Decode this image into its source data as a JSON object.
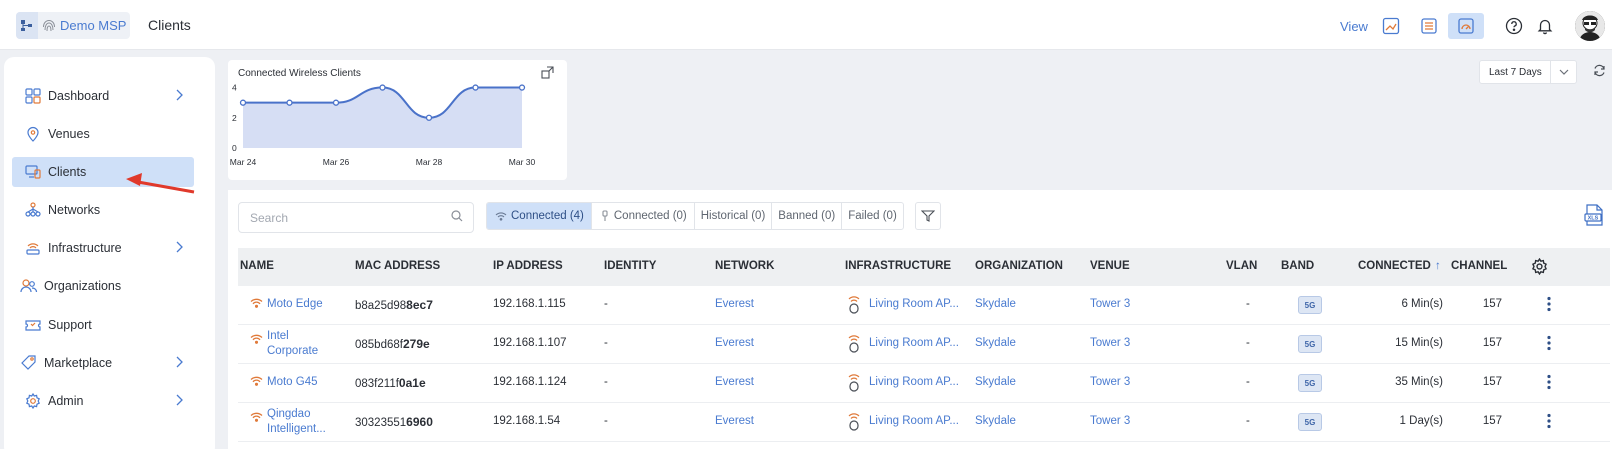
{
  "header": {
    "org_name": "Demo MSP",
    "page_title": "Clients",
    "view_label": "View",
    "view_buttons": [
      "view-map-icon",
      "view-list-icon",
      "view-dashboard-icon"
    ],
    "icons": [
      "help-icon",
      "bell-icon"
    ]
  },
  "sidebar": {
    "items": [
      {
        "label": "Dashboard",
        "icon": "grid-icon",
        "chevron": true
      },
      {
        "label": "Venues",
        "icon": "location-pin-icon",
        "chevron": false
      },
      {
        "label": "Clients",
        "icon": "devices-icon",
        "chevron": false,
        "active": true
      },
      {
        "label": "Networks",
        "icon": "network-icon",
        "chevron": false
      },
      {
        "label": "Infrastructure",
        "icon": "access-point-icon",
        "chevron": true
      },
      {
        "label": "Organizations",
        "icon": "users-icon",
        "chevron": false
      },
      {
        "label": "Support",
        "icon": "ticket-icon",
        "chevron": false
      },
      {
        "label": "Marketplace",
        "icon": "tag-icon",
        "chevron": true
      },
      {
        "label": "Admin",
        "icon": "gear-icon",
        "chevron": true
      }
    ]
  },
  "chart_widget": {
    "title": "Connected Wireless Clients",
    "range": "Last 7 Days"
  },
  "chart_data": {
    "type": "area",
    "title": "Connected Wireless Clients",
    "x": [
      "Mar 24",
      "Mar 25",
      "Mar 26",
      "Mar 27",
      "Mar 28",
      "Mar 29",
      "Mar 30"
    ],
    "x_ticks": [
      "Mar 24",
      "Mar 26",
      "Mar 28",
      "Mar 30"
    ],
    "values": [
      3,
      3,
      3,
      4,
      2,
      4,
      4
    ],
    "y_ticks": [
      0,
      2,
      4
    ],
    "ylim": [
      0,
      4.5
    ],
    "color": "#4a72c9",
    "fill": "#d6def4",
    "grid": false
  },
  "toolbar": {
    "search_placeholder": "Search",
    "tabs": [
      {
        "label": "Connected (4)",
        "icon": "wifi-icon",
        "active": true
      },
      {
        "label": "Connected (0)",
        "icon": "wired-icon",
        "active": false
      },
      {
        "label": "Historical (0)",
        "active": false
      },
      {
        "label": "Banned (0)",
        "active": false
      },
      {
        "label": "Failed (0)",
        "active": false
      }
    ]
  },
  "table": {
    "columns": [
      "NAME",
      "MAC ADDRESS",
      "IP ADDRESS",
      "IDENTITY",
      "NETWORK",
      "INFRASTRUCTURE",
      "ORGANIZATION",
      "VENUE",
      "VLAN",
      "BAND",
      "CONNECTED",
      "CHANNEL"
    ],
    "sort_indicator": "↑",
    "rows": [
      {
        "name": [
          "Moto Edge"
        ],
        "mac_prefix": "b8a25d98",
        "mac_suffix": "8ec7",
        "ip": "192.168.1.115",
        "identity": "-",
        "network": "Everest",
        "infrastructure": "Living Room AP...",
        "organization": "Skydale",
        "venue": "Tower 3",
        "vlan": "-",
        "band": "5G",
        "connected": "6 Min(s)",
        "channel": "157"
      },
      {
        "name": [
          "Intel",
          "Corporate"
        ],
        "mac_prefix": "085bd68f",
        "mac_suffix": "279e",
        "ip": "192.168.1.107",
        "identity": "-",
        "network": "Everest",
        "infrastructure": "Living Room AP...",
        "organization": "Skydale",
        "venue": "Tower 3",
        "vlan": "-",
        "band": "5G",
        "connected": "15 Min(s)",
        "channel": "157"
      },
      {
        "name": [
          "Moto G45"
        ],
        "mac_prefix": "083f211f",
        "mac_suffix": "0a1e",
        "ip": "192.168.1.124",
        "identity": "-",
        "network": "Everest",
        "infrastructure": "Living Room AP...",
        "organization": "Skydale",
        "venue": "Tower 3",
        "vlan": "-",
        "band": "5G",
        "connected": "35 Min(s)",
        "channel": "157"
      },
      {
        "name": [
          "Qingdao",
          "Intelligent..."
        ],
        "mac_prefix": "30323551",
        "mac_suffix": "6960",
        "ip": "192.168.1.54",
        "identity": "-",
        "network": "Everest",
        "infrastructure": "Living Room AP...",
        "organization": "Skydale",
        "venue": "Tower 3",
        "vlan": "-",
        "band": "5G",
        "connected": "1 Day(s)",
        "channel": "157"
      }
    ]
  }
}
